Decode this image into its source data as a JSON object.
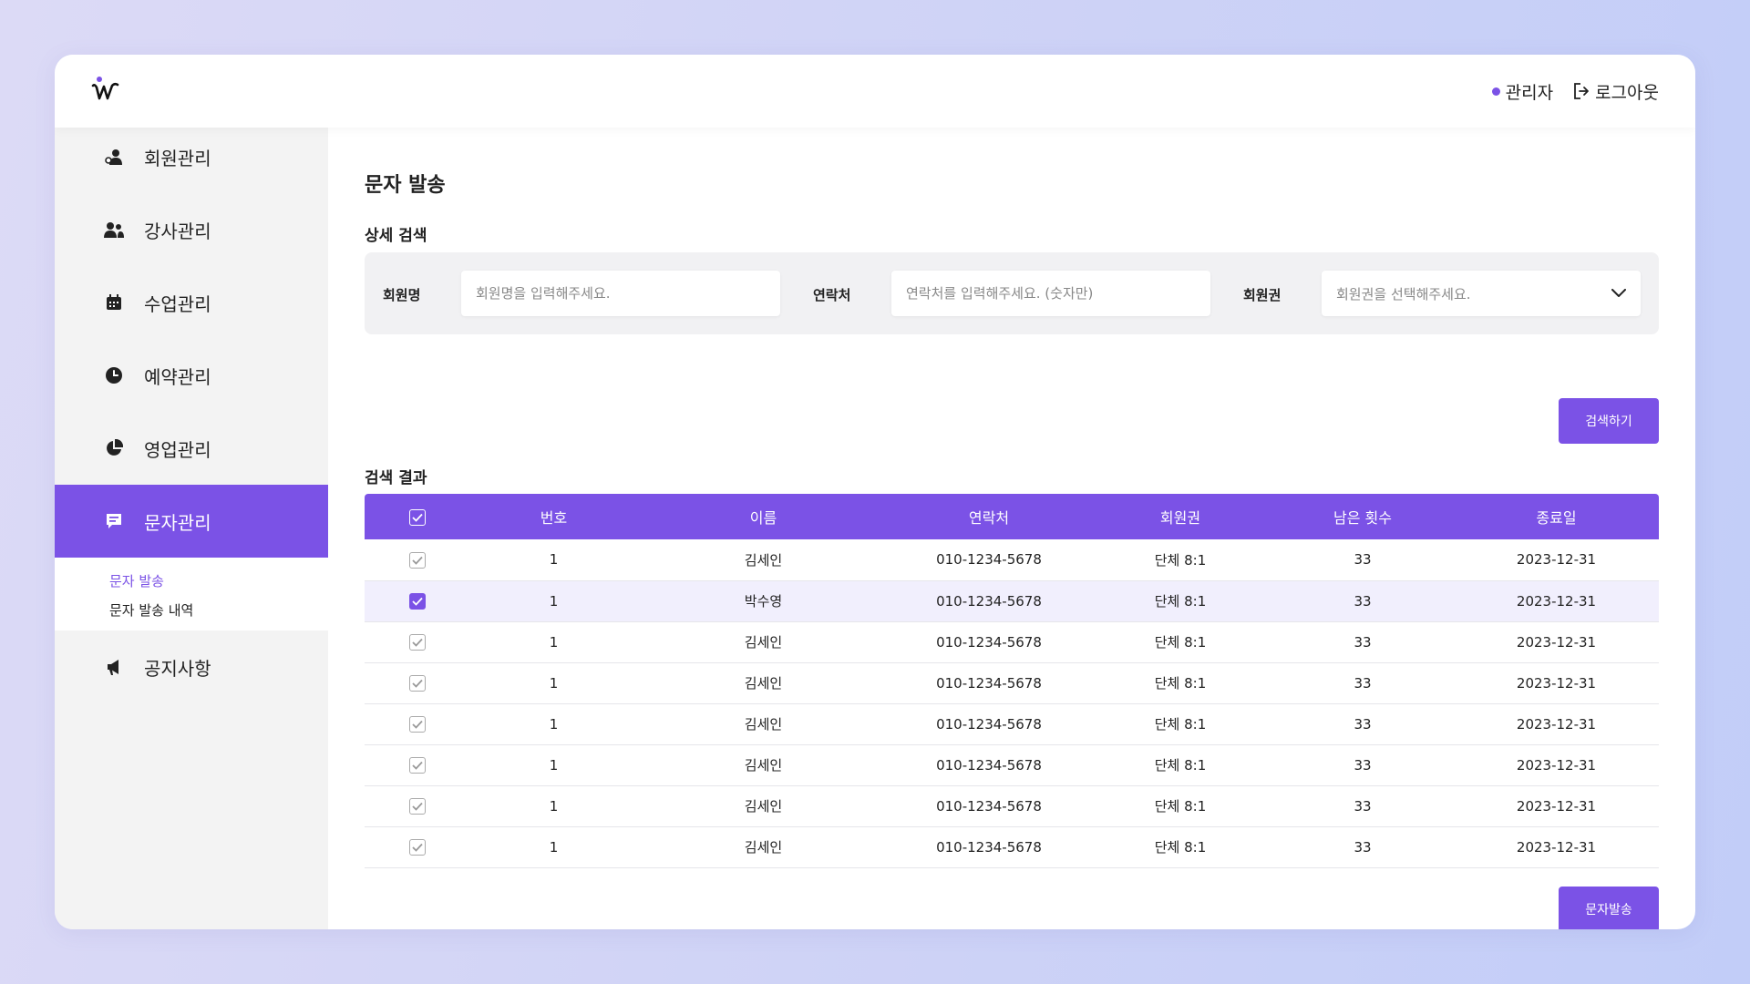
{
  "header": {
    "admin_label": "관리자",
    "logout_label": "로그아웃",
    "accent": "#7b52e6"
  },
  "sidebar": {
    "items": [
      {
        "label": "회원관리",
        "icon": "member-icon"
      },
      {
        "label": "강사관리",
        "icon": "users-icon"
      },
      {
        "label": "수업관리",
        "icon": "calendar-icon"
      },
      {
        "label": "예약관리",
        "icon": "clock-icon"
      },
      {
        "label": "영업관리",
        "icon": "pie-chart-icon"
      },
      {
        "label": "문자관리",
        "icon": "message-icon",
        "active": true
      },
      {
        "label": "공지사항",
        "icon": "megaphone-icon"
      }
    ],
    "submenu": [
      "문자 발송",
      "문자 발송 내역"
    ]
  },
  "main": {
    "title": "문자 발송",
    "search_section": "상세 검색",
    "fields": {
      "name_label": "회원명",
      "name_placeholder": "회원명을 입력해주세요.",
      "phone_label": "연락처",
      "phone_placeholder": "연락처를 입력해주세요. (숫자만)",
      "ticket_label": "회원권",
      "ticket_placeholder": "회원권을 선택해주세요."
    },
    "search_button": "검색하기",
    "results_section": "검색 결과",
    "send_button": "문자발송"
  },
  "table": {
    "columns": [
      "번호",
      "이름",
      "연락처",
      "회원권",
      "남은 횟수",
      "종료일"
    ],
    "rows": [
      {
        "no": "1",
        "name": "김세인",
        "phone": "010-1234-5678",
        "ticket": "단체 8:1",
        "remaining": "33",
        "end": "2023-12-31",
        "checked": false
      },
      {
        "no": "1",
        "name": "박수영",
        "phone": "010-1234-5678",
        "ticket": "단체 8:1",
        "remaining": "33",
        "end": "2023-12-31",
        "checked": true
      },
      {
        "no": "1",
        "name": "김세인",
        "phone": "010-1234-5678",
        "ticket": "단체 8:1",
        "remaining": "33",
        "end": "2023-12-31",
        "checked": false
      },
      {
        "no": "1",
        "name": "김세인",
        "phone": "010-1234-5678",
        "ticket": "단체 8:1",
        "remaining": "33",
        "end": "2023-12-31",
        "checked": false
      },
      {
        "no": "1",
        "name": "김세인",
        "phone": "010-1234-5678",
        "ticket": "단체 8:1",
        "remaining": "33",
        "end": "2023-12-31",
        "checked": false
      },
      {
        "no": "1",
        "name": "김세인",
        "phone": "010-1234-5678",
        "ticket": "단체 8:1",
        "remaining": "33",
        "end": "2023-12-31",
        "checked": false
      },
      {
        "no": "1",
        "name": "김세인",
        "phone": "010-1234-5678",
        "ticket": "단체 8:1",
        "remaining": "33",
        "end": "2023-12-31",
        "checked": false
      },
      {
        "no": "1",
        "name": "김세인",
        "phone": "010-1234-5678",
        "ticket": "단체 8:1",
        "remaining": "33",
        "end": "2023-12-31",
        "checked": false
      }
    ]
  }
}
